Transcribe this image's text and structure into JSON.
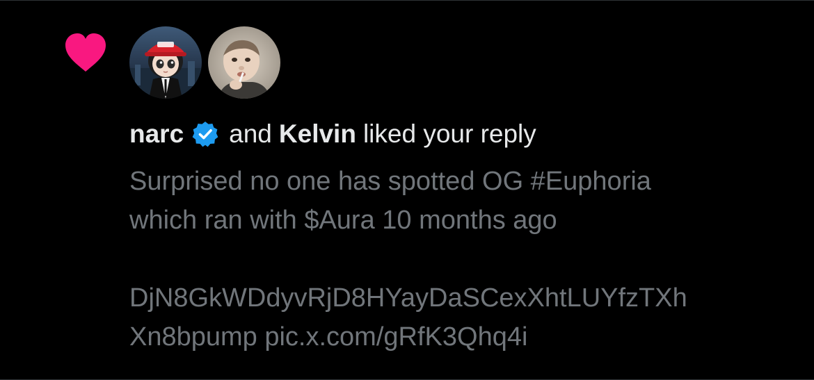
{
  "notification": {
    "type": "like",
    "heart_color": "#f91880",
    "verified_color": "#1d9bf0",
    "first_user": {
      "name": "narc",
      "verified": true,
      "avatar": "anime-character-red-cap-avatar"
    },
    "connector": "and",
    "second_user": {
      "name": "Kelvin",
      "avatar": "child-photo-avatar"
    },
    "action_text": "liked your reply",
    "reply_text": {
      "line1": "Surprised no one has spotted OG #Euphoria",
      "line2": "which ran with $Aura 10 months ago",
      "line3": "DjN8GkWDdyvRjD8HYayDaSCexXhtLUYfzTXh",
      "line4": "Xn8bpump pic.x.com/gRfK3Qhq4i"
    }
  },
  "icons": {
    "heart": "heart-icon",
    "verified": "verified-badge-icon"
  }
}
